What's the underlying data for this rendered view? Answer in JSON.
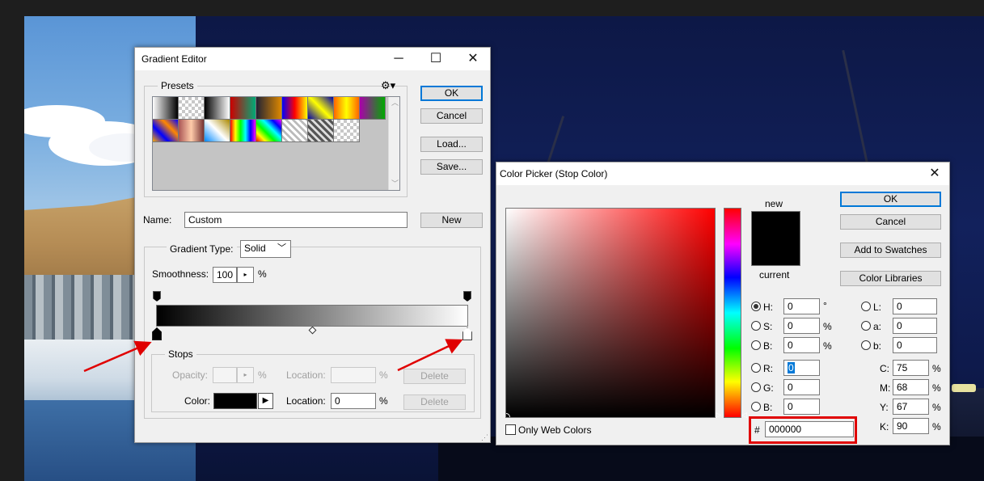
{
  "gradient_editor": {
    "title": "Gradient Editor",
    "window_buttons": {
      "minimize": "─",
      "maximize": "☐",
      "close": "✕"
    },
    "presets_label": "Presets",
    "ok": "OK",
    "cancel": "Cancel",
    "load": "Load...",
    "save": "Save...",
    "name_label": "Name:",
    "name_value": "Custom",
    "new_button": "New",
    "gradient_type_label": "Gradient Type:",
    "gradient_type_value": "Solid",
    "smoothness_label": "Smoothness:",
    "smoothness_value": "100",
    "smoothness_unit": "%",
    "stops": {
      "label": "Stops",
      "opacity_label": "Opacity:",
      "opacity_value": "",
      "opacity_unit": "%",
      "location_label_top": "Location:",
      "location_unit_top": "%",
      "delete_top": "Delete",
      "color_label": "Color:",
      "location_label": "Location:",
      "location_value": "0",
      "location_unit": "%",
      "delete_bottom": "Delete",
      "color_value": "#000000"
    },
    "gradient": {
      "start": "#000000",
      "end": "#ffffff"
    }
  },
  "color_picker": {
    "title": "Color Picker (Stop Color)",
    "close": "✕",
    "ok": "OK",
    "cancel": "Cancel",
    "add_to_swatches": "Add to Swatches",
    "color_libraries": "Color Libraries",
    "new_label": "new",
    "current_label": "current",
    "new_color": "#000000",
    "current_color": "#000000",
    "only_web_colors": "Only Web Colors",
    "hex_symbol": "#",
    "hex_value": "000000",
    "hsb": [
      {
        "label": "H:",
        "value": "0",
        "unit": "°",
        "selected": true
      },
      {
        "label": "S:",
        "value": "0",
        "unit": "%",
        "selected": false
      },
      {
        "label": "B:",
        "value": "0",
        "unit": "%",
        "selected": false
      }
    ],
    "rgb": [
      {
        "label": "R:",
        "value": "0"
      },
      {
        "label": "G:",
        "value": "0"
      },
      {
        "label": "B:",
        "value": "0"
      }
    ],
    "lab": [
      {
        "label": "L:",
        "value": "0"
      },
      {
        "label": "a:",
        "value": "0"
      },
      {
        "label": "b:",
        "value": "0"
      }
    ],
    "cmyk": [
      {
        "label": "C:",
        "value": "75",
        "unit": "%"
      },
      {
        "label": "M:",
        "value": "68",
        "unit": "%"
      },
      {
        "label": "Y:",
        "value": "67",
        "unit": "%"
      },
      {
        "label": "K:",
        "value": "90",
        "unit": "%"
      }
    ],
    "field_hue": "#ff0000"
  },
  "colors": {
    "accent": "#0078d7",
    "highlight_box": "#e00000",
    "arrow": "#e00000"
  }
}
